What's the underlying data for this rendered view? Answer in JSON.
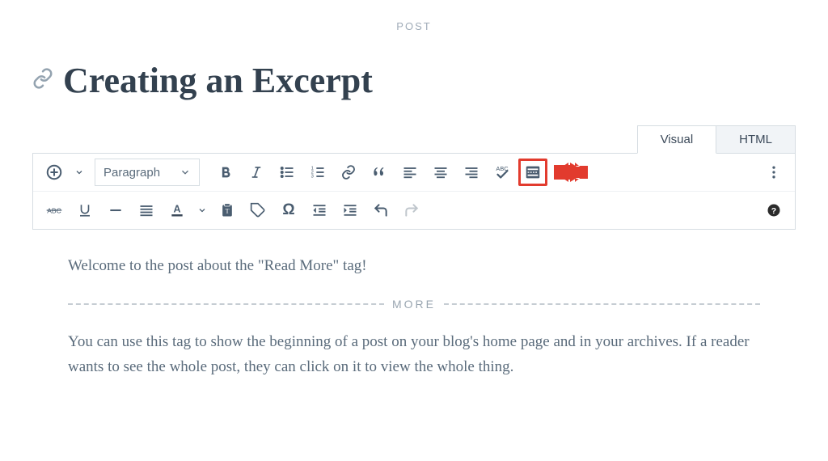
{
  "header": {
    "post_label": "POST"
  },
  "title": "Creating an Excerpt",
  "tabs": {
    "visual": "Visual",
    "html": "HTML"
  },
  "toolbar": {
    "paragraph_label": "Paragraph",
    "spellcheck_label": "ABC"
  },
  "more_separator": {
    "label": "MORE"
  },
  "content": {
    "p1": "Welcome to the post about the \"Read More\" tag!",
    "p2": "You can use this tag to show the beginning of a post on your blog's home page and in your archives. If a reader wants to see the whole post, they can click on it to view the whole thing."
  }
}
